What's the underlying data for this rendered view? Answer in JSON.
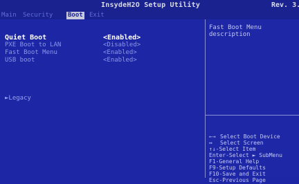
{
  "title": "InsydeH2O Setup Utility",
  "revision": "Rev. 3.5",
  "tabs": [
    "Main",
    "Security",
    "Boot",
    "Exit"
  ],
  "active_tab": "Boot",
  "settings": [
    {
      "label": "Quiet Boot",
      "value": "<Enabled>",
      "highlighted": true
    },
    {
      "label": "PXE Boot to LAN",
      "value": "<Disabled>",
      "highlighted": false
    },
    {
      "label": "Fast Boot Menu",
      "value": "<Enabled>",
      "highlighted": false
    },
    {
      "label": "USB boot",
      "value": "<Enabled>",
      "highlighted": false
    }
  ],
  "legacy_item": "►Legacy",
  "help": {
    "description_lines": [
      "Fast Boot Menu",
      "description"
    ],
    "keys": [
      {
        "key": "←→",
        "text": "Select Boot Device"
      },
      {
        "key": "↔",
        "text": "Select Screen"
      },
      {
        "key": "",
        "text": "↑↓-Select Item"
      },
      {
        "key": "",
        "text": "Enter-Select ► SubMenu"
      },
      {
        "key": "",
        "text": "F1-General Help"
      },
      {
        "key": "",
        "text": "F9-Setup Defaults"
      },
      {
        "key": "",
        "text": "F10-Save and Exit"
      },
      {
        "key": "",
        "text": "Esc-Previous Page"
      }
    ]
  },
  "colors": {
    "background": "#1d27a6",
    "highlight_text": "#ffffff",
    "normal_text": "#8c97e6",
    "active_tab_bg": "#c7c8d9"
  }
}
